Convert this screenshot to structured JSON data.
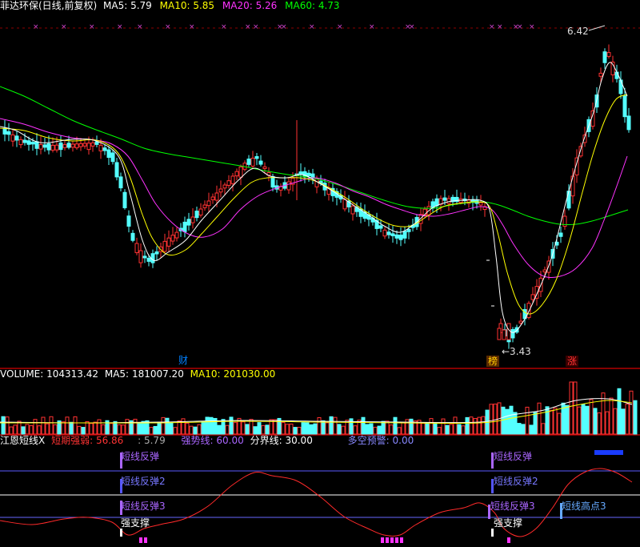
{
  "main_panel": {
    "title": "菲达环保(日线,前复权)",
    "ma5": {
      "label": "MA5:",
      "value": "5.79",
      "color": "#ffffff"
    },
    "ma10": {
      "label": "MA10:",
      "value": "5.85",
      "color": "#ffff00"
    },
    "ma20": {
      "label": "MA20:",
      "value": "5.26",
      "color": "#ff33ff"
    },
    "ma60": {
      "label": "MA60:",
      "value": "4.73",
      "color": "#00ff00"
    },
    "high_label": "6.42",
    "low_label": "←3.43",
    "badges": {
      "cai": "财",
      "bang": "榜",
      "zhang": "涨"
    }
  },
  "volume_panel": {
    "volume": {
      "label": "VOLUME:",
      "value": "104313.42",
      "color": "#ffffff"
    },
    "ma5": {
      "label": "MA5:",
      "value": "181007.20",
      "color": "#ffffff"
    },
    "ma10": {
      "label": "MA10:",
      "value": "201030.00",
      "color": "#ffff00"
    }
  },
  "indicator_panel": {
    "name": "江恩短线X",
    "short_strength": {
      "label": "短期强弱:",
      "value": "56.86",
      "color": "#ff3333"
    },
    "value_blank": ": 5.79",
    "strong_line": {
      "label": "强势线:",
      "value": "60.00",
      "color": "#aa66ff"
    },
    "divider_line": {
      "label": "分界线:",
      "value": "30.00",
      "color": "#ffffff"
    },
    "bull_bear": {
      "label": "多空预警:",
      "value": "0.00",
      "color": "#8888ff"
    },
    "signals": {
      "rebound": "短线反弹",
      "rebound2": "短线反弹2",
      "rebound3": "短线反弹3",
      "strong_support": "强支撑",
      "short_high3": "短线高点3"
    }
  },
  "colors": {
    "up": "#ff3232",
    "down": "#54ffff",
    "ma5": "#ffffff",
    "ma10": "#ffff00",
    "ma20": "#ff33ff",
    "ma60": "#00ff00",
    "grid": "#8b0000"
  }
}
